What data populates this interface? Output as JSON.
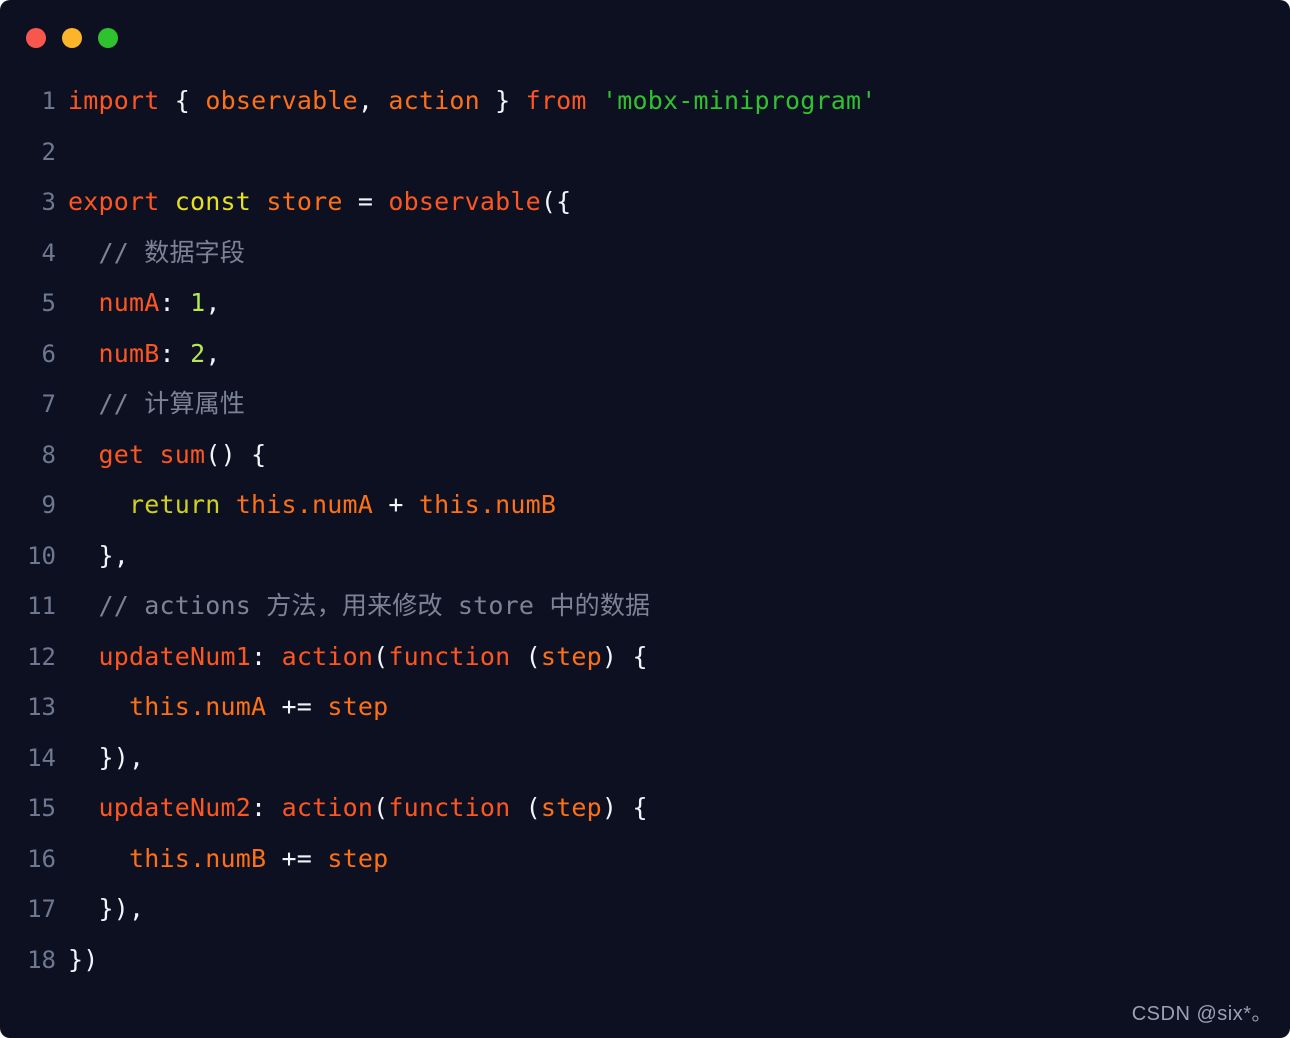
{
  "window": {
    "background": "#0d1021",
    "traffic_lights": [
      {
        "name": "close",
        "color": "#f9574e"
      },
      {
        "name": "minimize",
        "color": "#fcb52b"
      },
      {
        "name": "maximize",
        "color": "#2fc22f"
      }
    ]
  },
  "editor": {
    "language": "javascript",
    "line_numbers": [
      "1",
      "2",
      "3",
      "4",
      "5",
      "6",
      "7",
      "8",
      "9",
      "10",
      "11",
      "12",
      "13",
      "14",
      "15",
      "16",
      "17",
      "18"
    ],
    "lines": [
      {
        "number": "1",
        "text": "import { observable, action } from 'mobx-miniprogram'",
        "tokens": [
          {
            "t": "import",
            "c": "t-kw"
          },
          {
            "t": " ",
            "c": "t-punc"
          },
          {
            "t": "{",
            "c": "t-punc"
          },
          {
            "t": " ",
            "c": "t-punc"
          },
          {
            "t": "observable",
            "c": "t-var"
          },
          {
            "t": ",",
            "c": "t-punc"
          },
          {
            "t": " ",
            "c": "t-punc"
          },
          {
            "t": "action",
            "c": "t-var"
          },
          {
            "t": " ",
            "c": "t-punc"
          },
          {
            "t": "}",
            "c": "t-punc"
          },
          {
            "t": " ",
            "c": "t-punc"
          },
          {
            "t": "from",
            "c": "t-kw"
          },
          {
            "t": " ",
            "c": "t-punc"
          },
          {
            "t": "'mobx-miniprogram'",
            "c": "t-str"
          }
        ]
      },
      {
        "number": "2",
        "text": "",
        "tokens": []
      },
      {
        "number": "3",
        "text": "export const store = observable({",
        "tokens": [
          {
            "t": "export",
            "c": "t-kw"
          },
          {
            "t": " ",
            "c": "t-punc"
          },
          {
            "t": "const",
            "c": "t-kw2"
          },
          {
            "t": " ",
            "c": "t-punc"
          },
          {
            "t": "store",
            "c": "t-var"
          },
          {
            "t": " ",
            "c": "t-punc"
          },
          {
            "t": "=",
            "c": "t-punc"
          },
          {
            "t": " ",
            "c": "t-punc"
          },
          {
            "t": "observable",
            "c": "t-fn"
          },
          {
            "t": "({",
            "c": "t-punc"
          }
        ]
      },
      {
        "number": "4",
        "text": "  // 数据字段",
        "tokens": [
          {
            "t": "  ",
            "c": "t-punc"
          },
          {
            "t": "// 数据字段",
            "c": "t-comment"
          }
        ]
      },
      {
        "number": "5",
        "text": "  numA: 1,",
        "tokens": [
          {
            "t": "  ",
            "c": "t-punc"
          },
          {
            "t": "numA",
            "c": "t-prop"
          },
          {
            "t": ":",
            "c": "t-punc"
          },
          {
            "t": " ",
            "c": "t-punc"
          },
          {
            "t": "1",
            "c": "t-num"
          },
          {
            "t": ",",
            "c": "t-punc"
          }
        ]
      },
      {
        "number": "6",
        "text": "  numB: 2,",
        "tokens": [
          {
            "t": "  ",
            "c": "t-punc"
          },
          {
            "t": "numB",
            "c": "t-prop"
          },
          {
            "t": ":",
            "c": "t-punc"
          },
          {
            "t": " ",
            "c": "t-punc"
          },
          {
            "t": "2",
            "c": "t-num"
          },
          {
            "t": ",",
            "c": "t-punc"
          }
        ]
      },
      {
        "number": "7",
        "text": "  // 计算属性",
        "tokens": [
          {
            "t": "  ",
            "c": "t-punc"
          },
          {
            "t": "// 计算属性",
            "c": "t-comment"
          }
        ]
      },
      {
        "number": "8",
        "text": "  get sum() {",
        "tokens": [
          {
            "t": "  ",
            "c": "t-punc"
          },
          {
            "t": "get",
            "c": "t-kw"
          },
          {
            "t": " ",
            "c": "t-punc"
          },
          {
            "t": "sum",
            "c": "t-fn"
          },
          {
            "t": "()",
            "c": "t-punc"
          },
          {
            "t": " ",
            "c": "t-punc"
          },
          {
            "t": "{",
            "c": "t-punc"
          }
        ]
      },
      {
        "number": "9",
        "text": "    return this.numA + this.numB",
        "tokens": [
          {
            "t": "    ",
            "c": "t-punc"
          },
          {
            "t": "return",
            "c": "t-kw3"
          },
          {
            "t": " ",
            "c": "t-punc"
          },
          {
            "t": "this.numA",
            "c": "t-var"
          },
          {
            "t": " ",
            "c": "t-punc"
          },
          {
            "t": "+",
            "c": "t-punc"
          },
          {
            "t": " ",
            "c": "t-punc"
          },
          {
            "t": "this.numB",
            "c": "t-var"
          }
        ]
      },
      {
        "number": "10",
        "text": "  },",
        "tokens": [
          {
            "t": "  ",
            "c": "t-punc"
          },
          {
            "t": "},",
            "c": "t-punc"
          }
        ]
      },
      {
        "number": "11",
        "text": "  // actions 方法，用来修改 store 中的数据",
        "tokens": [
          {
            "t": "  ",
            "c": "t-punc"
          },
          {
            "t": "// actions 方法，用来修改 store 中的数据",
            "c": "t-comment"
          }
        ]
      },
      {
        "number": "12",
        "text": "  updateNum1: action(function (step) {",
        "tokens": [
          {
            "t": "  ",
            "c": "t-punc"
          },
          {
            "t": "updateNum1",
            "c": "t-prop"
          },
          {
            "t": ":",
            "c": "t-punc"
          },
          {
            "t": " ",
            "c": "t-punc"
          },
          {
            "t": "action",
            "c": "t-fn"
          },
          {
            "t": "(",
            "c": "t-punc"
          },
          {
            "t": "function",
            "c": "t-kw"
          },
          {
            "t": " ",
            "c": "t-punc"
          },
          {
            "t": "(",
            "c": "t-punc"
          },
          {
            "t": "step",
            "c": "t-var"
          },
          {
            "t": ")",
            "c": "t-punc"
          },
          {
            "t": " ",
            "c": "t-punc"
          },
          {
            "t": "{",
            "c": "t-punc"
          }
        ]
      },
      {
        "number": "13",
        "text": "    this.numA += step",
        "tokens": [
          {
            "t": "    ",
            "c": "t-punc"
          },
          {
            "t": "this.numA",
            "c": "t-var"
          },
          {
            "t": " ",
            "c": "t-punc"
          },
          {
            "t": "+=",
            "c": "t-punc"
          },
          {
            "t": " ",
            "c": "t-punc"
          },
          {
            "t": "step",
            "c": "t-var"
          }
        ]
      },
      {
        "number": "14",
        "text": "  }),",
        "tokens": [
          {
            "t": "  ",
            "c": "t-punc"
          },
          {
            "t": "}),",
            "c": "t-punc"
          }
        ]
      },
      {
        "number": "15",
        "text": "  updateNum2: action(function (step) {",
        "tokens": [
          {
            "t": "  ",
            "c": "t-punc"
          },
          {
            "t": "updateNum2",
            "c": "t-prop"
          },
          {
            "t": ":",
            "c": "t-punc"
          },
          {
            "t": " ",
            "c": "t-punc"
          },
          {
            "t": "action",
            "c": "t-fn"
          },
          {
            "t": "(",
            "c": "t-punc"
          },
          {
            "t": "function",
            "c": "t-kw"
          },
          {
            "t": " ",
            "c": "t-punc"
          },
          {
            "t": "(",
            "c": "t-punc"
          },
          {
            "t": "step",
            "c": "t-var"
          },
          {
            "t": ")",
            "c": "t-punc"
          },
          {
            "t": " ",
            "c": "t-punc"
          },
          {
            "t": "{",
            "c": "t-punc"
          }
        ]
      },
      {
        "number": "16",
        "text": "    this.numB += step",
        "tokens": [
          {
            "t": "    ",
            "c": "t-punc"
          },
          {
            "t": "this.numB",
            "c": "t-var"
          },
          {
            "t": " ",
            "c": "t-punc"
          },
          {
            "t": "+=",
            "c": "t-punc"
          },
          {
            "t": " ",
            "c": "t-punc"
          },
          {
            "t": "step",
            "c": "t-var"
          }
        ]
      },
      {
        "number": "17",
        "text": "  }),",
        "tokens": [
          {
            "t": "  ",
            "c": "t-punc"
          },
          {
            "t": "}),",
            "c": "t-punc"
          }
        ]
      },
      {
        "number": "18",
        "text": "})",
        "tokens": [
          {
            "t": "})",
            "c": "t-punc"
          }
        ]
      }
    ]
  },
  "watermark": {
    "text": "CSDN @six*。"
  }
}
